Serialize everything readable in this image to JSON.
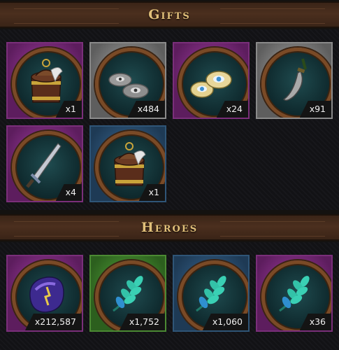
{
  "gifts": {
    "title": "Gifts",
    "items": [
      {
        "icon": "chest-icon",
        "rarity": "purple",
        "qty": "x1"
      },
      {
        "icon": "silver-eye-coins-icon",
        "rarity": "gray",
        "qty": "x484"
      },
      {
        "icon": "gold-eye-coins-icon",
        "rarity": "purple",
        "qty": "x24"
      },
      {
        "icon": "curved-dagger-icon",
        "rarity": "gray",
        "qty": "x91"
      },
      {
        "icon": "sword-icon",
        "rarity": "purple",
        "qty": "x4"
      },
      {
        "icon": "chest-icon",
        "rarity": "blue",
        "qty": "x1"
      }
    ]
  },
  "heroes": {
    "title": "Heroes",
    "items": [
      {
        "icon": "purple-gem-icon",
        "rarity": "purple",
        "qty": "x212,587"
      },
      {
        "icon": "laurel-leaf-icon",
        "rarity": "green",
        "qty": "x1,752"
      },
      {
        "icon": "laurel-leaf-icon",
        "rarity": "blue",
        "qty": "x1,060"
      },
      {
        "icon": "laurel-leaf-icon",
        "rarity": "purple",
        "qty": "x36"
      }
    ]
  },
  "colors": {
    "header_text": "#e2c07a",
    "rarity_purple": "#7a2f7a",
    "rarity_gray": "#8a8a8a",
    "rarity_blue": "#2f5577",
    "rarity_green": "#4b8a33"
  }
}
